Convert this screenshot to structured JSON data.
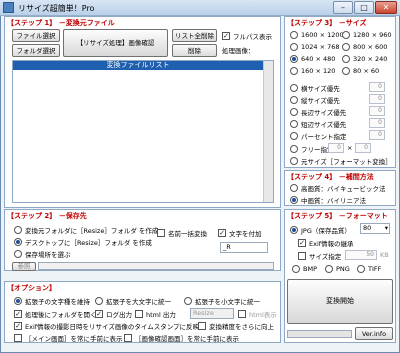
{
  "window": {
    "title": "リサイズ超簡単！Pro"
  },
  "step1": {
    "heading": "【ステップ 1】 －変換元ファイル",
    "file_select": "ファイル選択",
    "folder_select": "フォルダ選択",
    "resize_confirm": "【リサイズ処理】画像確認",
    "clear_list": "リスト全削除",
    "delete": "削除",
    "fullpath_label": "フルパス表示",
    "fullpath_checked": true,
    "processing_label": "処理画像：",
    "list_header": "変換ファイルリスト"
  },
  "step2": {
    "heading": "【ステップ 2】 －保存先",
    "options": [
      {
        "label": "変換元フォルダに［Resize］フォルダ を作成",
        "selected": false
      },
      {
        "label": "デスクトップに［Resize］フォルダ を作成",
        "selected": true
      },
      {
        "label": "保存場所を選ぶ",
        "selected": false
      }
    ],
    "rename_label": "名前一括変換",
    "rename_checked": false,
    "add_text_label": "文字を付加",
    "add_text_checked": true,
    "suffix_value": "_R",
    "browse": "参照"
  },
  "step3": {
    "heading": "【ステップ 3】 －サイズ",
    "sizes": [
      {
        "label": "1600 × 1200",
        "selected": false
      },
      {
        "label": "1280 × 960",
        "selected": false
      },
      {
        "label": "1024 × 768",
        "selected": false
      },
      {
        "label": "800 × 600",
        "selected": false
      },
      {
        "label": "640 × 480",
        "selected": true
      },
      {
        "label": "320 × 240",
        "selected": false
      },
      {
        "label": "160 × 120",
        "selected": false
      },
      {
        "label": "80 × 60",
        "selected": false
      }
    ],
    "custom_options": [
      {
        "label": "横サイズ優先",
        "value": "0"
      },
      {
        "label": "縦サイズ優先",
        "value": "0"
      },
      {
        "label": "長辺サイズ優先",
        "value": "0"
      },
      {
        "label": "短辺サイズ優先",
        "value": "0"
      },
      {
        "label": "パーセント指定",
        "value": "0"
      }
    ],
    "free_label": "フリー指定",
    "free_w": "0",
    "free_x": "×",
    "free_h": "0",
    "original_label": "元サイズ［フォーマット変換］"
  },
  "step4": {
    "heading": "【ステップ 4】 －補間方法",
    "options": [
      {
        "label": "高画質：バイキュービック法",
        "selected": false
      },
      {
        "label": "中画質：バイリニア法",
        "selected": true
      }
    ]
  },
  "step5": {
    "heading": "【ステップ 5】 －フォーマット",
    "jpg_label": "JPG（保存品質）",
    "jpg_quality": "80",
    "exif_label": "Exif情報の継承",
    "exif_checked": true,
    "size_label": "サイズ指定",
    "size_value": "50",
    "size_unit": "KB",
    "formats": [
      {
        "label": "BMP",
        "selected": false
      },
      {
        "label": "PNG",
        "selected": false
      },
      {
        "label": "TIFF",
        "selected": false
      }
    ],
    "convert_button": "変換開始",
    "ver_button": "Ver.info"
  },
  "options": {
    "heading": "【オプション】",
    "ext_options": [
      {
        "label": "拡張子の文字種を維持",
        "selected": true
      },
      {
        "label": "拡張子を大文字に統一",
        "selected": false
      },
      {
        "label": "拡張子を小文字に統一",
        "selected": false
      }
    ],
    "open_folder_label": "処理後にフォルダを開く",
    "open_folder_checked": true,
    "log_label": "ログ出力",
    "log_checked": true,
    "html_output_label": "html 出力",
    "html_output_checked": false,
    "html_input_value": "Resize",
    "html_view_label": "html表示",
    "exif_timestamp_label": "Exif情報の撮影日時をリサイズ画像のタイムスタンプに反映",
    "exif_timestamp_checked": true,
    "sharpen_label": "変換精度をさらに向上",
    "sharpen_checked": false,
    "main_front_label": "［メイン画面］を常に手前に表示",
    "main_front_checked": false,
    "preview_front_label": "［画像確認画面］を常に手前に表示",
    "preview_front_checked": false
  }
}
